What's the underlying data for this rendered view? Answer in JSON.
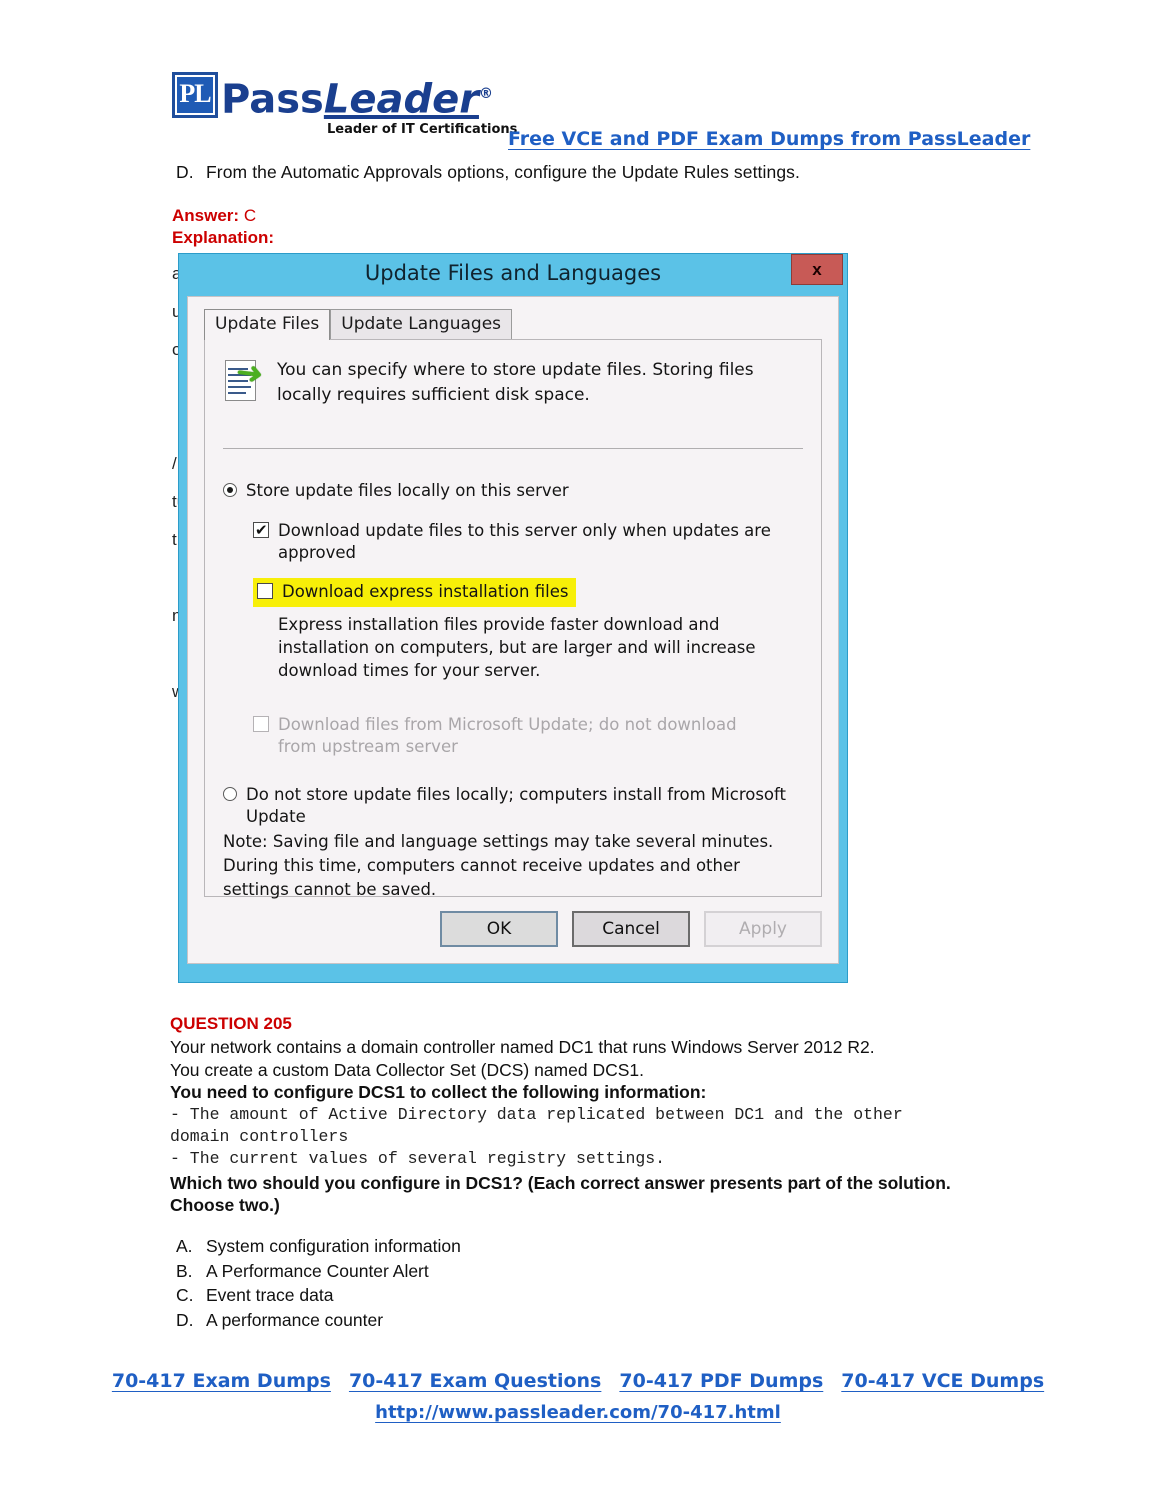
{
  "brand": {
    "badge": "PL",
    "name_part1": "Pass",
    "name_part2": "Leader",
    "registered": "®",
    "tagline": "Leader of IT Certifications",
    "header_link": "Free VCE and PDF Exam Dumps from PassLeader"
  },
  "prev_question": {
    "option_d_letter": "D.",
    "option_d_text": "From the Automatic Approvals options, configure the Update Rules settings.",
    "answer_label": "Answer:",
    "answer_value": "C",
    "explanation_label": "Explanation:"
  },
  "dialog": {
    "title": "Update Files and Languages",
    "close_label": "x",
    "tabs": [
      {
        "label": "Update Files",
        "active": true
      },
      {
        "label": "Update Languages",
        "active": false
      }
    ],
    "info_text": "You can specify where to store update files. Storing files locally requires sufficient disk space.",
    "options": {
      "radio_local_label": "Store update files locally on this server",
      "radio_local_selected": true,
      "check_approved_label": "Download update files to this server only when updates are approved",
      "check_approved_checked": true,
      "check_express_label": "Download express installation files",
      "check_express_checked": false,
      "check_express_highlighted": true,
      "express_description": "Express installation files provide faster download and installation on computers, but are larger and will increase download times for your server.",
      "check_msupdate_label": "Download files from Microsoft Update; do not download from upstream server",
      "check_msupdate_checked": false,
      "check_msupdate_disabled": true,
      "radio_remote_label": "Do not store update files locally; computers install from Microsoft Update",
      "radio_remote_selected": false
    },
    "note": "Note: Saving file and language settings may take several minutes. During this time, computers cannot receive updates and other settings cannot be saved.",
    "buttons": {
      "ok": "OK",
      "cancel": "Cancel",
      "apply": "Apply"
    }
  },
  "question": {
    "title": "QUESTION 205",
    "line1": "Your network contains a domain controller named DC1 that runs Windows Server 2012 R2.",
    "line2": "You create a custom Data Collector Set (DCS) named DCS1.",
    "line3": "You need to configure DCS1 to collect the following information:",
    "mono1": "- The amount of Active Directory data replicated between DC1 and the other",
    "mono2": "domain controllers",
    "mono3": "- The current values of several registry settings.",
    "line4": "Which two should you configure in DCS1? (Each correct answer presents part of the solution. Choose two.)",
    "options": [
      {
        "letter": "A.",
        "text": "System configuration information"
      },
      {
        "letter": "B.",
        "text": "A Performance Counter Alert"
      },
      {
        "letter": "C.",
        "text": "Event trace data"
      },
      {
        "letter": "D.",
        "text": "A performance counter"
      }
    ]
  },
  "footer": {
    "links": [
      "70-417 Exam Dumps",
      "70-417 Exam Questions",
      "70-417 PDF Dumps",
      "70-417 VCE Dumps"
    ],
    "url": "http://www.passleader.com/70-417.html"
  },
  "colors": {
    "brand_blue": "#1f5fc4",
    "answer_red": "#cc0000",
    "dialog_titlebar": "#5bc2e7",
    "close_red": "#c85a56",
    "highlight_yellow": "#f7ef08"
  }
}
